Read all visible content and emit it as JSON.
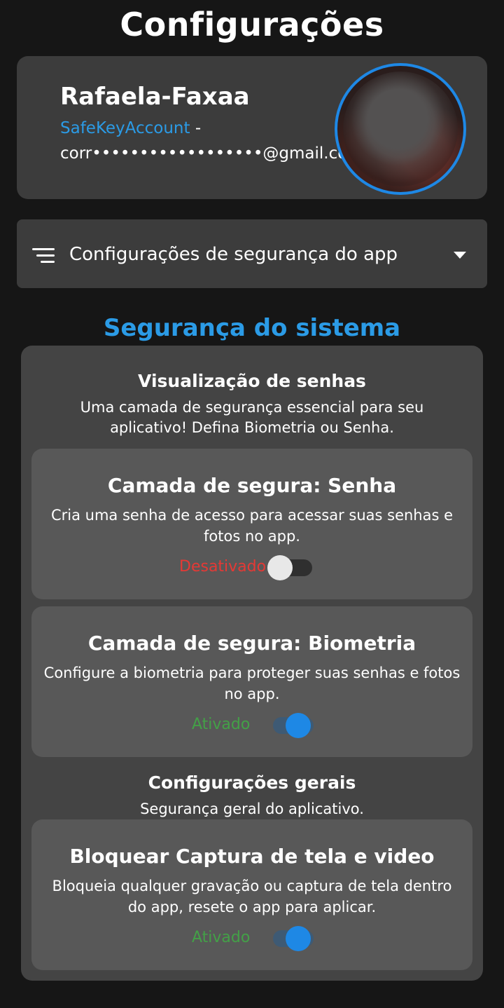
{
  "header": {
    "title": "Configurações"
  },
  "profile": {
    "name": "Rafaela-Faxaa",
    "account_label": "SafeKeyAccount",
    "account_separator": " -",
    "email": "corr••••••••••••••••••@gmail.com"
  },
  "settings_dropdown": {
    "label": "Configurações de segurança do app"
  },
  "section": {
    "title": "Segurança do sistema",
    "groups": [
      {
        "title": "Visualização de senhas",
        "description": "Uma camada de segurança essencial para seu aplicativo! Defina Biometria ou Senha."
      },
      {
        "title": "Configurações gerais",
        "description": "Segurança geral do aplicativo."
      }
    ],
    "options": [
      {
        "title": "Camada de segura: Senha",
        "description": "Cria uma senha de acesso para acessar suas senhas e fotos no app.",
        "status": "Desativado",
        "enabled": false
      },
      {
        "title": "Camada de segura: Biometria",
        "description": "Configure a biometria para proteger suas senhas e fotos no app.",
        "status": "Ativado",
        "enabled": true
      },
      {
        "title": "Bloquear Captura de tela e video",
        "description": "Bloqueia qualquer gravação ou captura de tela dentro do app, resete o app para aplicar.",
        "status": "Ativado",
        "enabled": true
      }
    ]
  },
  "colors": {
    "accent": "#2b9be6",
    "status_off": "#e53935",
    "status_on": "#43a047",
    "switch_on": "#1e88e5"
  },
  "icons": {
    "menu": "menu-lines-icon",
    "dropdown": "chevron-down-icon"
  }
}
